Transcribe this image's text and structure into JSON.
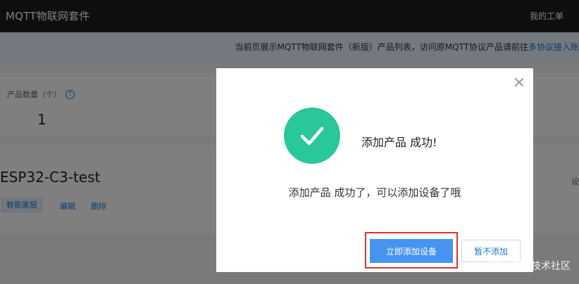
{
  "header": {
    "title": "MQTT物联网套件",
    "orders_link": "我的工单"
  },
  "notice": {
    "text": "当前页展示MQTT物联网套件（新版）产品列表，访问原MQTT协议产品请前往",
    "link": "多协议接入账"
  },
  "stats": {
    "label": "产品数量（个）",
    "help_icon": "question-circle-icon",
    "count": "1"
  },
  "product": {
    "name": "ESP32-C3-test",
    "tag": "智能家居",
    "edit": "编辑",
    "delete": "删除",
    "side_label": "设"
  },
  "dialog": {
    "heading": "添加产品 成功!",
    "message": "添加产品 成功了，可以添加设备了哦",
    "primary_button": "立即添加设备",
    "secondary_button": "暂不添加",
    "success_color": "#29c799"
  },
  "watermark": "@稀土掘金技术社区"
}
